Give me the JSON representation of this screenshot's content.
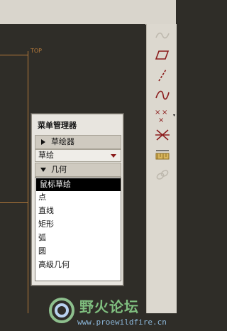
{
  "canvas": {
    "view_label": "TOP"
  },
  "menu_manager": {
    "title": "菜单管理器",
    "section_sketcher": "草绘器",
    "dropdown_value": "草绘",
    "section_geometry": "几何",
    "items": [
      "鼠标草绘",
      "点",
      "直线",
      "矩形",
      "弧",
      "圆",
      "高级几何"
    ],
    "selected_index": 0
  },
  "watermark": {
    "title": "野火论坛",
    "url": "www.proewildfire.cn"
  },
  "colors": {
    "canvas_bg": "#2f2d28",
    "datum_lines": "#b77b3b",
    "panel_bg": "#e8e5df"
  },
  "toolbar_icons": [
    "spline-icon",
    "parallelogram-icon",
    "line-icon",
    "wave-icon",
    "points-icon",
    "cross-icon",
    "dimension-icon",
    "link-icon"
  ]
}
